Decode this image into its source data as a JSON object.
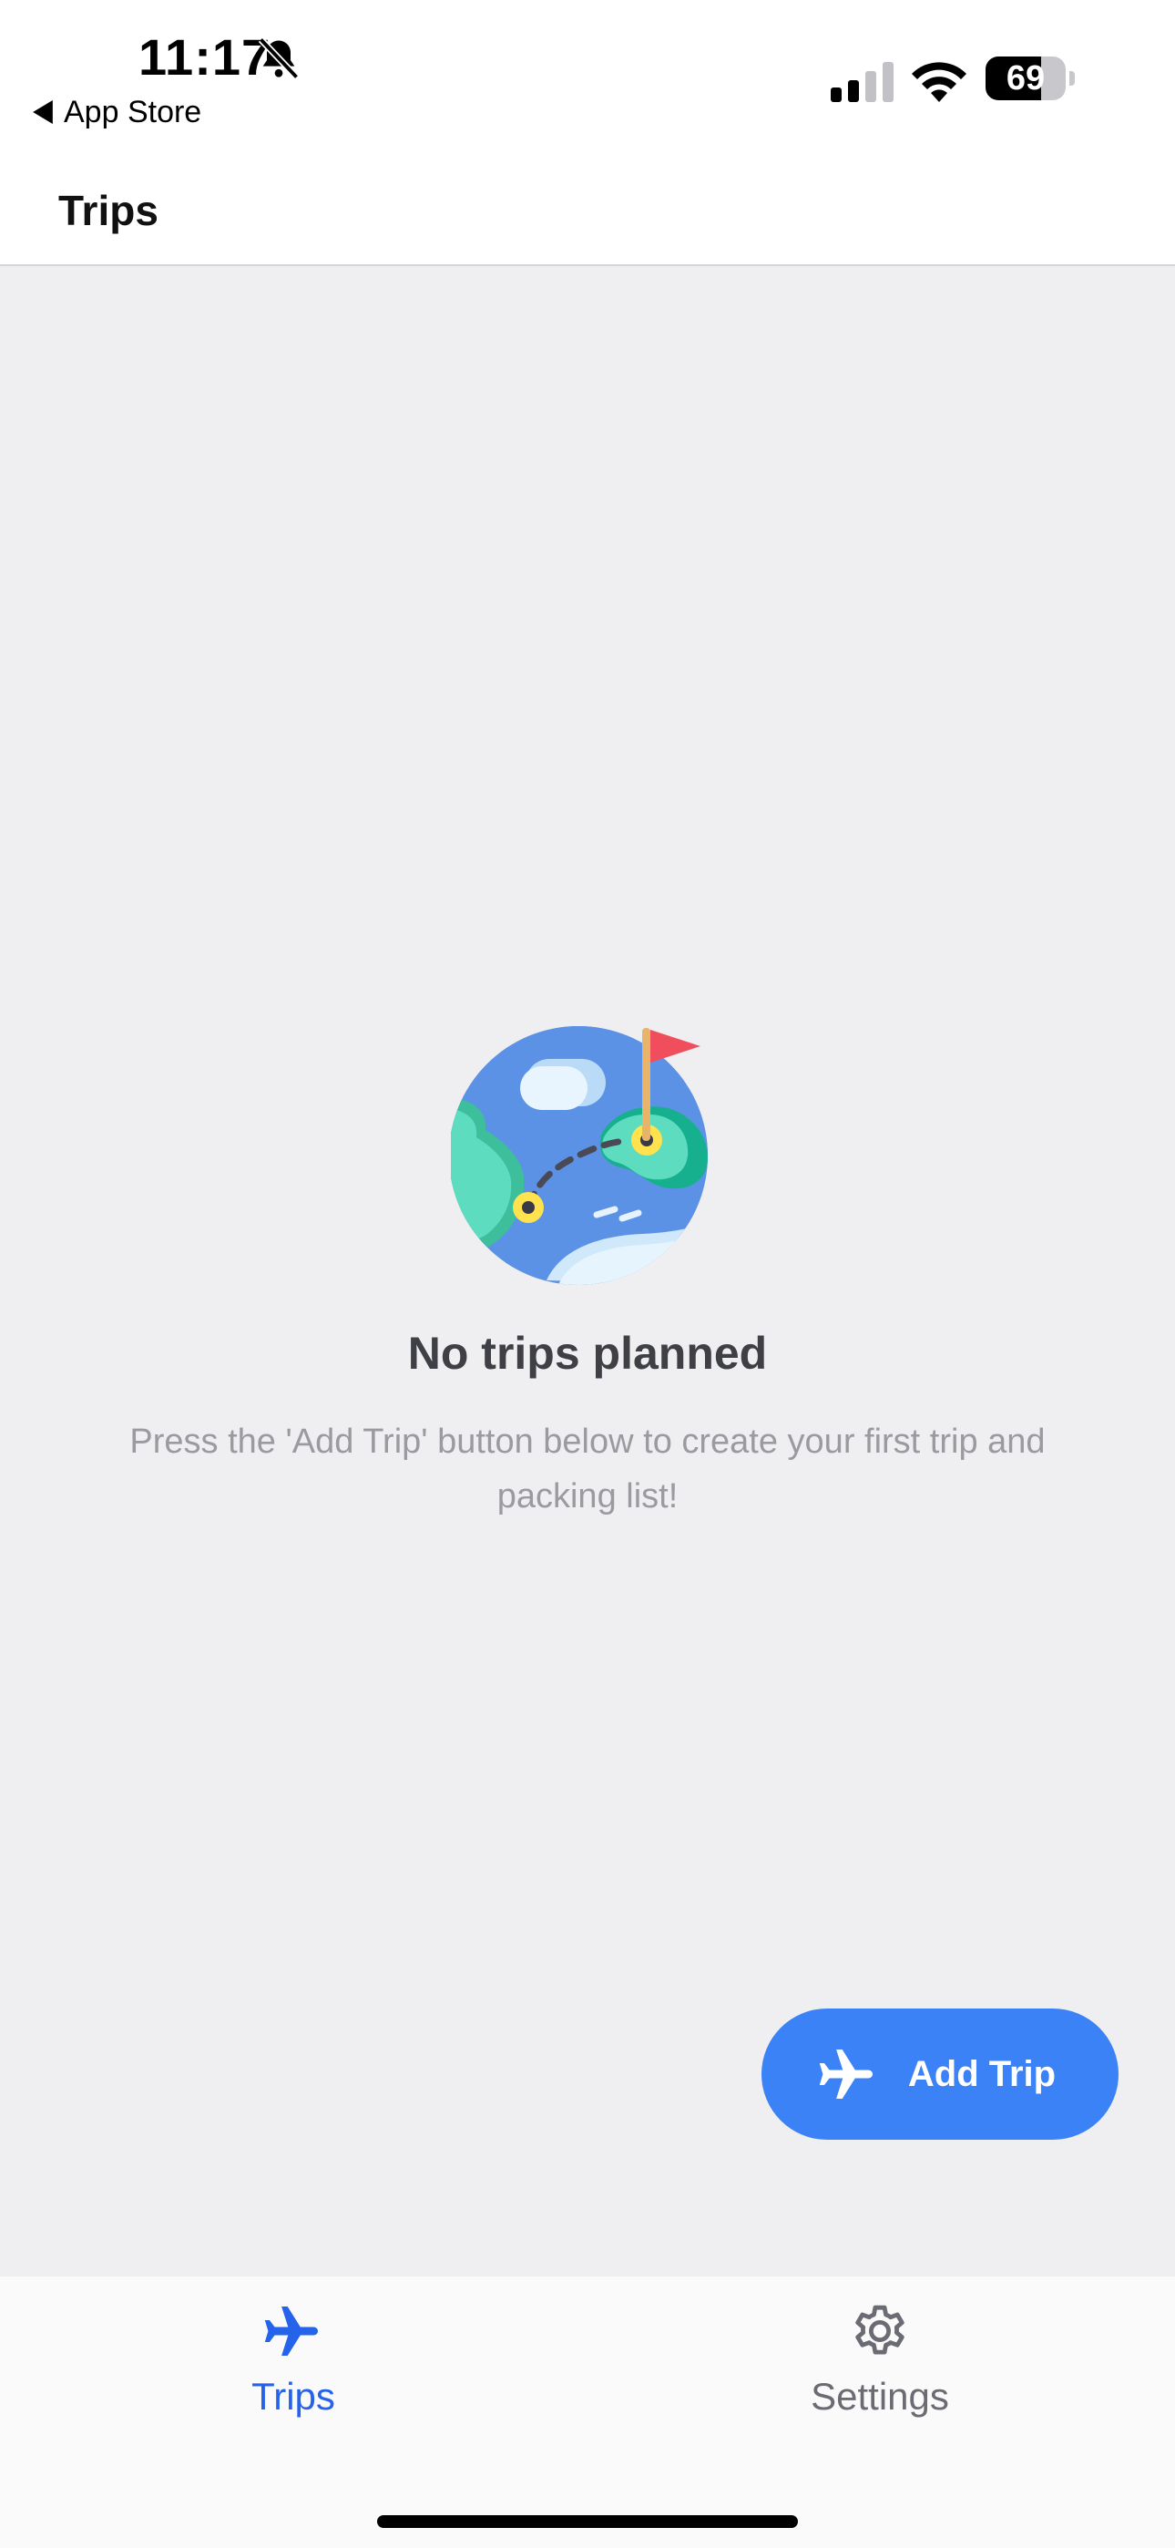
{
  "status_bar": {
    "time": "11:17",
    "back_label": "App Store",
    "battery_percent": 69,
    "battery_text": "69"
  },
  "header": {
    "title": "Trips"
  },
  "empty_state": {
    "title": "No trips planned",
    "description": "Press the 'Add Trip' button below to create your first trip and packing list!"
  },
  "fab": {
    "label": "Add Trip",
    "icon": "plane-icon"
  },
  "tab_bar": {
    "items": [
      {
        "label": "Trips",
        "icon": "plane-icon",
        "active": true
      },
      {
        "label": "Settings",
        "icon": "gear-icon",
        "active": false
      }
    ]
  },
  "colors": {
    "accent": "#3b82f6",
    "active_tab": "#2563eb",
    "background": "#efeff2"
  }
}
